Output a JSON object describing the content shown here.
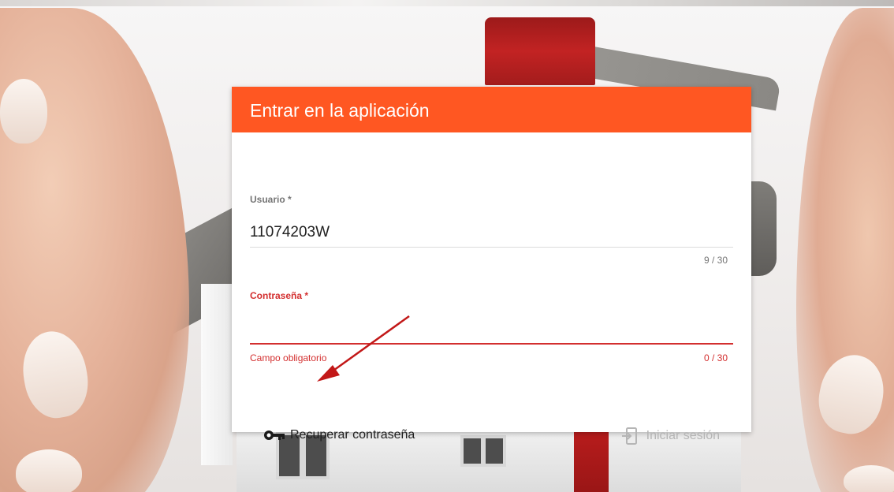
{
  "colors": {
    "header_bg": "#ff5722",
    "error": "#d32f2f",
    "disabled_text": "#b5b5b5",
    "annotation_arrow": "#c21818"
  },
  "login": {
    "title": "Entrar en la aplicación",
    "username": {
      "label": "Usuario *",
      "value": "11074203W",
      "counter": "9 / 30"
    },
    "password": {
      "label": "Contraseña *",
      "value": "",
      "error": "Campo obligatorio",
      "counter": "0 / 30"
    },
    "recover_label": "Recuperar contraseña",
    "recover_icon": "key-icon",
    "submit_label": "Iniciar sesión",
    "submit_icon": "login-icon"
  }
}
